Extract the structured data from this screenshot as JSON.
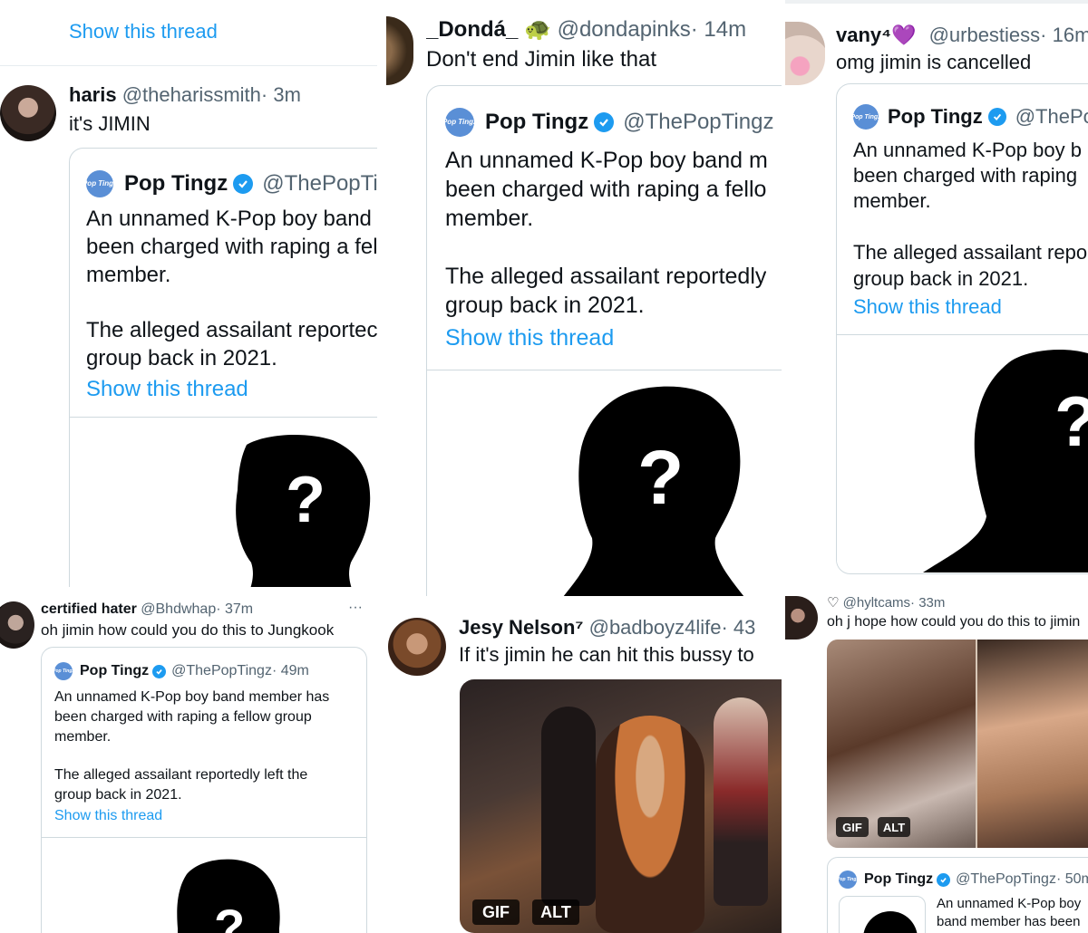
{
  "colors": {
    "link": "#1d9bf0",
    "verified": "#1d9bf0",
    "handle": "#536471",
    "border": "#cfd9de"
  },
  "panel1": {
    "top_link": "Show this thread",
    "user": {
      "name": "haris",
      "handle": "@theharissmith",
      "time": "· 3m"
    },
    "text": "it's JIMIN",
    "quote": {
      "name": "Pop Tingz",
      "handle": "@ThePopTin",
      "line1": "An unnamed K-Pop boy band",
      "line2": "been charged with raping a fel",
      "line3": "member.",
      "line4": "The alleged assailant reportec",
      "line5": "group back in 2021.",
      "show": "Show this thread"
    }
  },
  "panel2": {
    "user": {
      "name": "_Dondá_",
      "emoji": "🐢",
      "handle": "@dondapinks",
      "time": "· 14m"
    },
    "text": "Don't end Jimin like that",
    "quote": {
      "name": "Pop Tingz",
      "handle": "@ThePopTingz",
      "line1": "An unnamed K-Pop boy band m",
      "line2": "been charged with raping a fello",
      "line3": "member.",
      "line4": "The alleged assailant reportedly",
      "line5": "group back in 2021.",
      "show": "Show this thread"
    }
  },
  "panel3": {
    "user": {
      "name": "vany⁴",
      "emoji": "💜",
      "handle": "@urbestiess",
      "time": "· 16m"
    },
    "text": "omg jimin is cancelled",
    "quote": {
      "name": "Pop Tingz",
      "handle": "@ThePop",
      "line1": "An unnamed K-Pop boy b",
      "line2": "been charged with raping",
      "line3": "member.",
      "line4": "The alleged assailant repo",
      "line5": "group back in 2021.",
      "show": "Show this thread"
    }
  },
  "panel4": {
    "user": {
      "name": "certified hater",
      "handle": "@Bhdwhap",
      "time": "· 37m",
      "more": "···"
    },
    "text": "oh jimin how could you do this to Jungkook",
    "quote": {
      "name": "Pop Tingz",
      "handle": "@ThePopTingz",
      "time": "· 49m",
      "line1": "An unnamed K-Pop boy band member has",
      "line2": "been charged with raping a fellow group",
      "line3": "member.",
      "line4": "The alleged assailant reportedly left the",
      "line5": "group back in 2021.",
      "show": "Show this thread"
    }
  },
  "panel5": {
    "user": {
      "name": "Jesy Nelson⁷",
      "handle": "@badboyz4life",
      "time": "· 43"
    },
    "text": "If it's jimin he can hit this bussy to",
    "gif": "GIF",
    "alt": "ALT"
  },
  "panel6": {
    "user": {
      "icon": "♡",
      "handle": "@hyltcams",
      "time": "· 33m"
    },
    "text": "oh j hope how could you do this to jimin",
    "gif": "GIF",
    "alt": "ALT",
    "quote": {
      "name": "Pop Tingz",
      "handle": "@ThePopTingz",
      "time": "· 50m",
      "line1": "An unnamed K-Pop boy",
      "line2": "band member has been"
    }
  },
  "logo_text": "Pop\nTingz",
  "silhouette_mark": "?"
}
